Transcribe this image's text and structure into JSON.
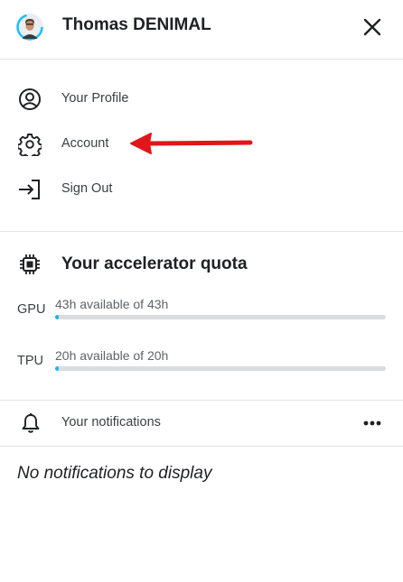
{
  "header": {
    "user_name": "Thomas DENIMAL",
    "avatar_icon": "user-avatar",
    "close_icon": "close-icon"
  },
  "menu": {
    "items": [
      {
        "label": "Your Profile",
        "icon": "user-circle-icon"
      },
      {
        "label": "Account",
        "icon": "gear-icon"
      },
      {
        "label": "Sign Out",
        "icon": "sign-out-icon"
      }
    ]
  },
  "annotation": {
    "arrow_color": "#e0161b"
  },
  "quota": {
    "title": "Your accelerator quota",
    "icon": "chip-icon",
    "resources": [
      {
        "name": "GPU",
        "text": "43h available of 43h",
        "used_fraction": 0.0
      },
      {
        "name": "TPU",
        "text": "20h available of 20h",
        "used_fraction": 0.0
      }
    ],
    "bar_color": "#1ab7ea"
  },
  "notifications": {
    "label": "Your notifications",
    "icon": "bell-icon",
    "more_icon": "more-horizontal-icon",
    "empty_message": "No notifications to display"
  }
}
